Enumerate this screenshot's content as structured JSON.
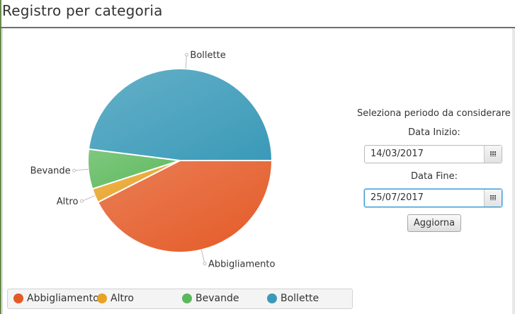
{
  "header": {
    "title": "Registro per categoria"
  },
  "chart_data": {
    "type": "pie",
    "categories": [
      "Abbigliamento",
      "Altro",
      "Bevande",
      "Bollette"
    ],
    "values": [
      42.5,
      2.5,
      7.0,
      48.0
    ],
    "colors": [
      "#e45a26",
      "#e8a225",
      "#5cb85c",
      "#3a9ab8"
    ],
    "start_angle": 0,
    "direction": "clockwise-from-east",
    "legend_position": "bottom"
  },
  "legend": {
    "items": [
      {
        "label": "Abbigliamento",
        "color": "#e45a26"
      },
      {
        "label": "Altro",
        "color": "#e8a225"
      },
      {
        "label": "Bevande",
        "color": "#5cb85c"
      },
      {
        "label": "Bollette",
        "color": "#3a9ab8"
      }
    ]
  },
  "form": {
    "heading": "Seleziona periodo da considerare",
    "start_label": "Data Inizio:",
    "start_value": "14/03/2017",
    "end_label": "Data Fine:",
    "end_value": "25/07/2017",
    "update_label": "Aggiorna",
    "calendar_icon": "calendar-icon"
  }
}
